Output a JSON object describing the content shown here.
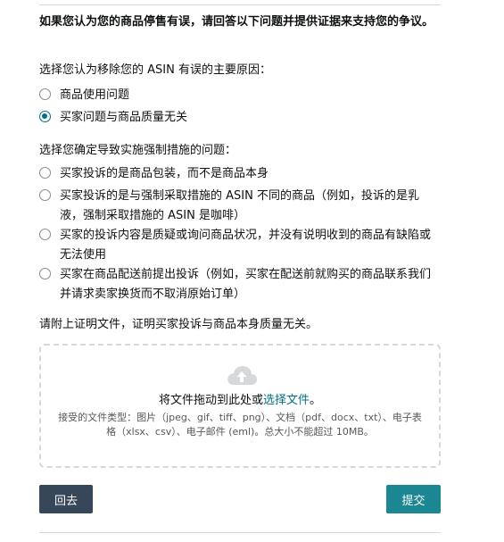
{
  "form": {
    "intro": "如果您认为您的商品停售有误，请回答以下问题并提供证据来支持您的争议。",
    "reason_label": "选择您认为移除您的 ASIN 有误的主要原因：",
    "reasons": [
      {
        "label": "商品使用问题",
        "checked": false
      },
      {
        "label": "买家问题与商品质量无关",
        "checked": true
      }
    ],
    "issue_label": "选择您确定导致实施强制措施的问题：",
    "issues": [
      {
        "label": "买家投诉的是商品包装，而不是商品本身",
        "checked": false
      },
      {
        "label": "买家投诉的是与强制采取措施的 ASIN 不同的商品（例如，投诉的是乳液，强制采取措施的 ASIN 是咖啡）",
        "checked": false
      },
      {
        "label": "买家的投诉内容是质疑或询问商品状况，并没有说明收到的商品有缺陷或无法使用",
        "checked": false
      },
      {
        "label": "买家在商品配送前提出投诉（例如，买家在配送前就购买的商品联系我们并请求卖家换货而不取消原始订单）",
        "checked": false
      }
    ],
    "attach_label": "请附上证明文件，证明买家投诉与商品本身质量无关。"
  },
  "upload": {
    "icon": "cloud-upload-icon",
    "drag_text": "将文件拖动到此处或",
    "choose_link": "选择文件",
    "drag_suffix": "。",
    "accepted_types": "接受的文件类型：图片（jpeg、gif、tiff、png）、文档（pdf、docx、txt）、电子表格（xlsx、csv）、电子邮件 (eml)。总大小不能超过 10MB。"
  },
  "buttons": {
    "back": "回去",
    "submit": "提交"
  },
  "colors": {
    "accent": "#007185",
    "back_button": "#37475a",
    "submit_button": "#1a8793"
  }
}
